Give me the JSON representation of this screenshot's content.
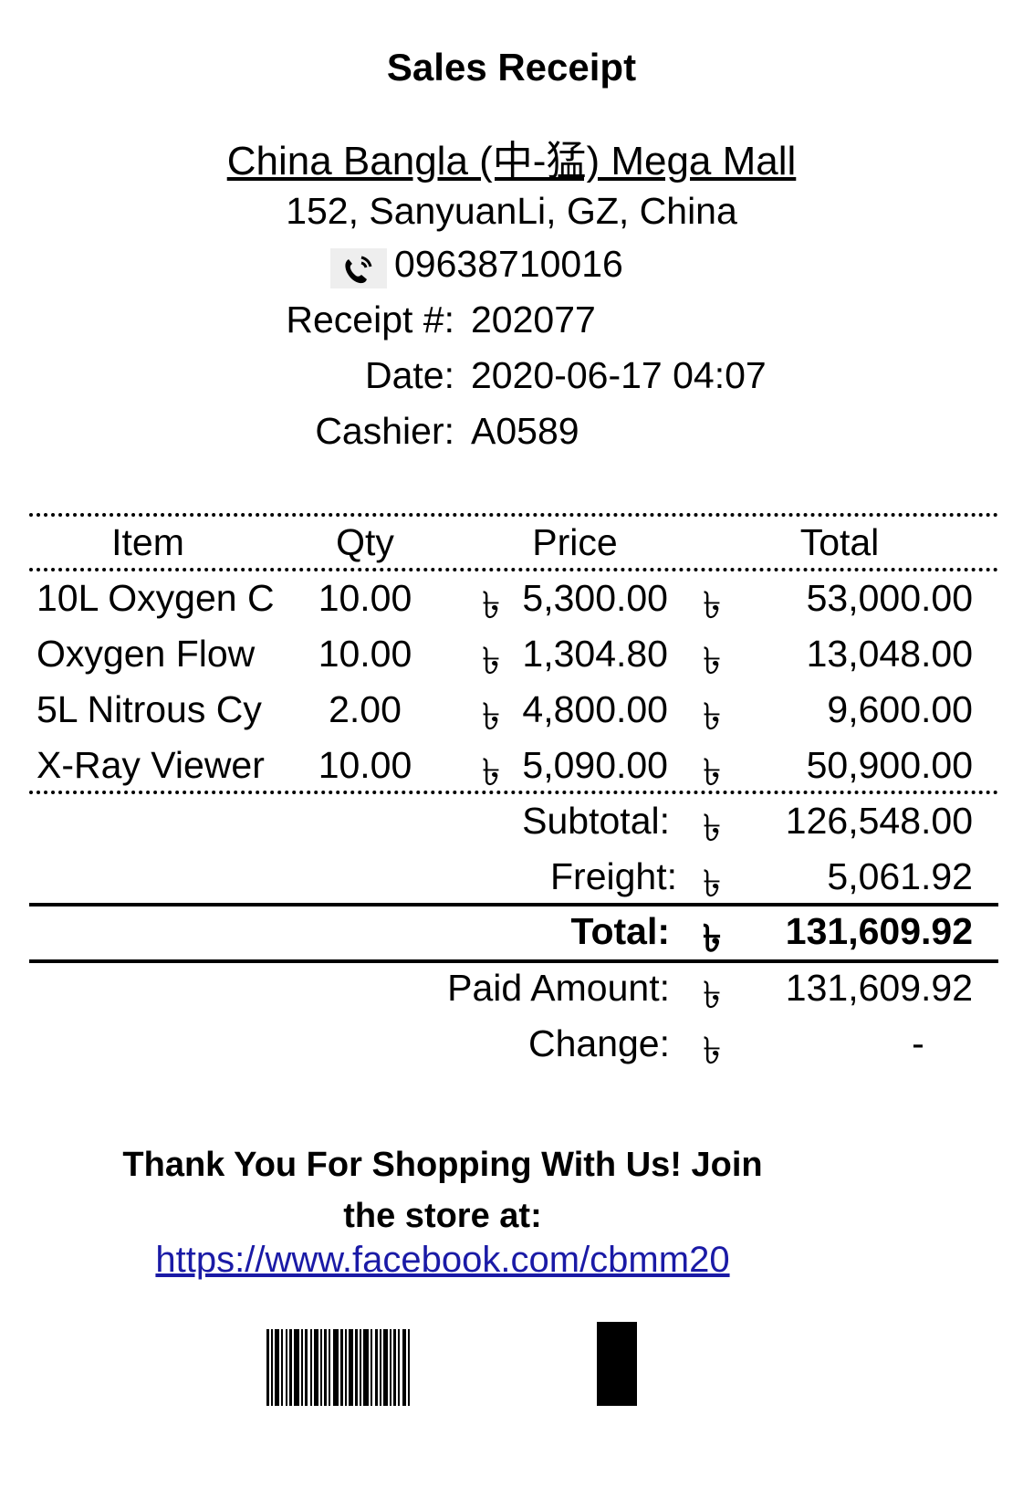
{
  "header": {
    "title": "Sales Receipt",
    "store_name": "China Bangla (中-猛) Mega Mall",
    "address": "152, SanyuanLi, GZ, China",
    "phone_icon": "phone-icon",
    "phone": "09638710016"
  },
  "meta": {
    "receipt_label": "Receipt #:",
    "receipt_value": "202077",
    "date_label": "Date:",
    "date_value": "2020-06-17 04:07",
    "cashier_label": "Cashier:",
    "cashier_value": "A0589"
  },
  "table": {
    "headers": {
      "item": "Item",
      "qty": "Qty",
      "price": "Price",
      "total": "Total"
    },
    "currency": "৳",
    "rows": [
      {
        "item": "10L Oxygen C",
        "qty": "10.00",
        "price": "5,300.00",
        "total": "53,000.00"
      },
      {
        "item": "Oxygen Flow",
        "qty": "10.00",
        "price": "1,304.80",
        "total": "13,048.00"
      },
      {
        "item": "5L Nitrous Cy",
        "qty": "2.00",
        "price": "4,800.00",
        "total": "9,600.00"
      },
      {
        "item": "X-Ray Viewer",
        "qty": "10.00",
        "price": "5,090.00",
        "total": "50,900.00"
      }
    ]
  },
  "summary": {
    "subtotal_label": "Subtotal:",
    "subtotal_value": "126,548.00",
    "freight_label": "Freight:",
    "freight_value": "5,061.92",
    "total_label": "Total:",
    "total_value": "131,609.92",
    "paid_label": "Paid Amount:",
    "paid_value": "131,609.92",
    "change_label": "Change:",
    "change_value": "-"
  },
  "footer": {
    "thanks_line1": "Thank You For Shopping With Us!   Join",
    "thanks_line2": "the store at:",
    "link": "https://www.facebook.com/cbmm20"
  }
}
